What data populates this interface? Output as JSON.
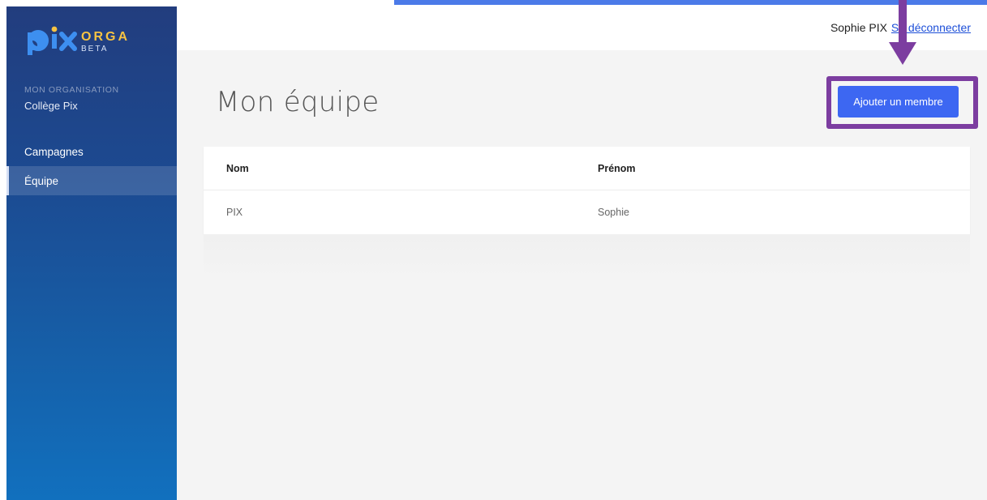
{
  "brand": {
    "logo_word": "pix",
    "logo_suffix": "ORGA",
    "logo_tag": "BETA",
    "colors": {
      "pix": "#3d8ff0",
      "orga": "#f6c343",
      "beta": "#d8e3f7"
    }
  },
  "sidebar": {
    "org_label": "MON ORGANISATION",
    "org_name": "Collège Pix",
    "items": [
      {
        "label": "Campagnes",
        "active": false
      },
      {
        "label": "Équipe",
        "active": true
      }
    ]
  },
  "header": {
    "user_name": "Sophie PIX",
    "logout_label": "Se déconnecter"
  },
  "main": {
    "title": "Mon équipe",
    "add_button_label": "Ajouter un membre",
    "table": {
      "columns": [
        "Nom",
        "Prénom"
      ],
      "rows": [
        [
          "PIX",
          "Sophie"
        ]
      ]
    }
  },
  "annotation": {
    "highlight_color": "#7c3da0",
    "arrow_icon": "arrow-down-icon"
  }
}
